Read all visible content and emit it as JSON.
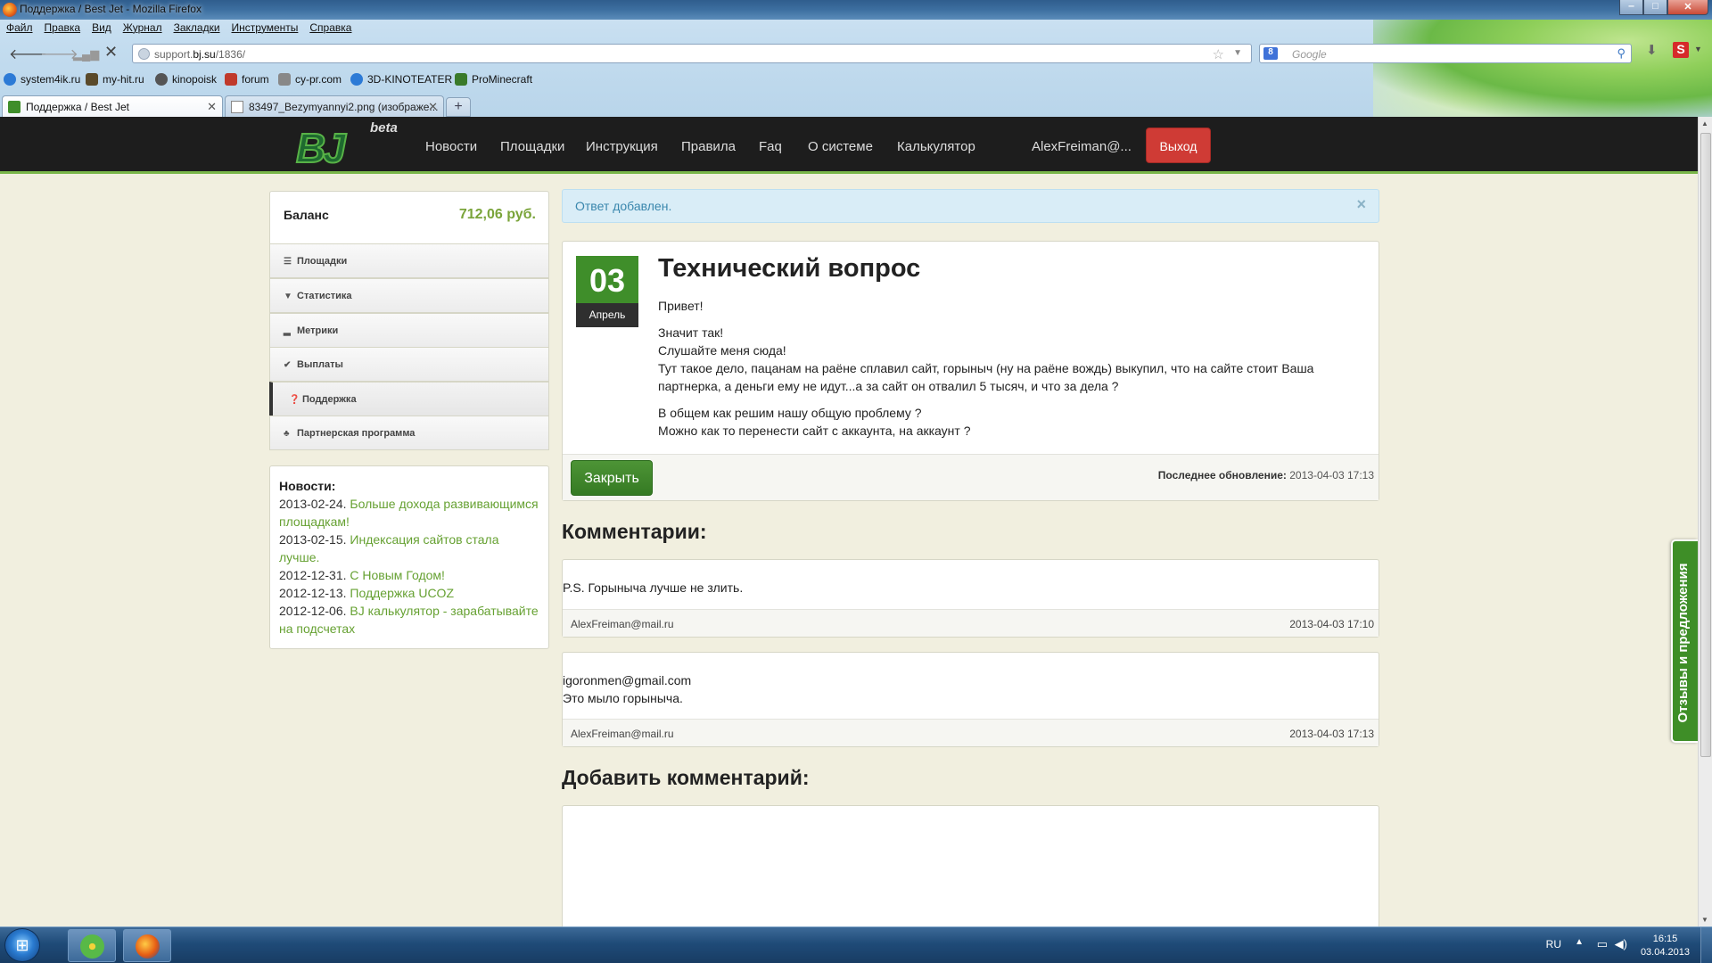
{
  "window": {
    "title": "Поддержка / Best Jet - Mozilla Firefox"
  },
  "menu": [
    "Файл",
    "Правка",
    "Вид",
    "Журнал",
    "Закладки",
    "Инструменты",
    "Справка"
  ],
  "nav": {
    "url_host": "support.",
    "url_domain": "bj.su",
    "url_path": "/1836/",
    "search_placeholder": "Google"
  },
  "bookmarks": [
    {
      "label": "system4ik.ru",
      "color": "#2c7ad6"
    },
    {
      "label": "my-hit.ru",
      "color": "#5a4a2a"
    },
    {
      "label": "kinopoisk",
      "color": "#555555"
    },
    {
      "label": "forum",
      "color": "#c0392b"
    },
    {
      "label": "cy-pr.com",
      "color": "#888888"
    },
    {
      "label": "3D-KINOTEATER",
      "color": "#2c7ad6"
    },
    {
      "label": "ProMinecraft",
      "color": "#3a7a2a"
    }
  ],
  "tabs": [
    {
      "label": "Поддержка / Best Jet"
    },
    {
      "label": "83497_Bezymyannyi2.png (изображе..."
    }
  ],
  "site": {
    "logo_text": "BJ",
    "logo_badge": "beta",
    "nav": [
      "Новости",
      "Площадки",
      "Инструкция",
      "Правила",
      "Faq",
      "О системе",
      "Калькулятор"
    ],
    "user": "AlexFreiman@...",
    "logout": "Выход",
    "accent": "#7ab74a"
  },
  "sidebar": {
    "balance_label": "Баланс",
    "balance_value": "712,06 руб.",
    "items": [
      {
        "label": "Площадки",
        "icon": "list-icon",
        "glyph": "☰"
      },
      {
        "label": "Статистика",
        "icon": "filter-icon",
        "glyph": "▼"
      },
      {
        "label": "Метрики",
        "icon": "signal-icon",
        "glyph": "▂"
      },
      {
        "label": "Выплаты",
        "icon": "check-circle-icon",
        "glyph": "✔"
      },
      {
        "label": "Поддержка",
        "icon": "question-circle-icon",
        "glyph": "❓"
      },
      {
        "label": "Партнерская программа",
        "icon": "sitemap-icon",
        "glyph": "♣"
      }
    ]
  },
  "news": {
    "heading": "Новости:",
    "items": [
      {
        "date": "2013-02-24.",
        "title": "Больше дохода развивающимся площадкам!"
      },
      {
        "date": "2013-02-15.",
        "title": "Индексация сайтов стала лучше."
      },
      {
        "date": "2012-12-31.",
        "title": "С Новым Годом!"
      },
      {
        "date": "2012-12-13.",
        "title": "Поддержка UCOZ"
      },
      {
        "date": "2012-12-06.",
        "title": "BJ калькулятор - зарабатывайте на подсчетах"
      }
    ]
  },
  "alert": {
    "text": "Ответ добавлен."
  },
  "ticket": {
    "day": "03",
    "month": "Апрель",
    "title": "Технический вопрос",
    "paragraphs": [
      [
        "Привет!"
      ],
      [
        "Значит так!",
        "Слушайте меня сюда!",
        "Тут такое дело, пацанам на раёне сплавил сайт, горыныч (ну на раёне вождь) выкупил, что на сайте стоит Ваша партнерка, а деньги ему не идут...а за сайт он отвалил 5 тысяч, и что за дела ?"
      ],
      [
        "В общем как решим нашу общую проблему ?",
        "Можно как то перенести сайт с аккаунта, на аккаунт ?"
      ]
    ],
    "close_label": "Закрыть",
    "updated_label": "Последнее обновление:",
    "updated_value": "2013-04-03 17:13"
  },
  "comments_heading": "Комментарии:",
  "comments": [
    {
      "lines": [
        "P.S. Горыныча лучше не злить."
      ],
      "author": "AlexFreiman@mail.ru",
      "time": "2013-04-03 17:10"
    },
    {
      "lines": [
        "igoronmen@gmail.com",
        "Это мыло горыныча."
      ],
      "author": "AlexFreiman@mail.ru",
      "time": "2013-04-03 17:13"
    }
  ],
  "add_comment_heading": "Добавить комментарий:",
  "feedback_tab": "Отзывы и предложения",
  "taskbar": {
    "lang": "RU",
    "time": "16:15",
    "date": "03.04.2013"
  }
}
